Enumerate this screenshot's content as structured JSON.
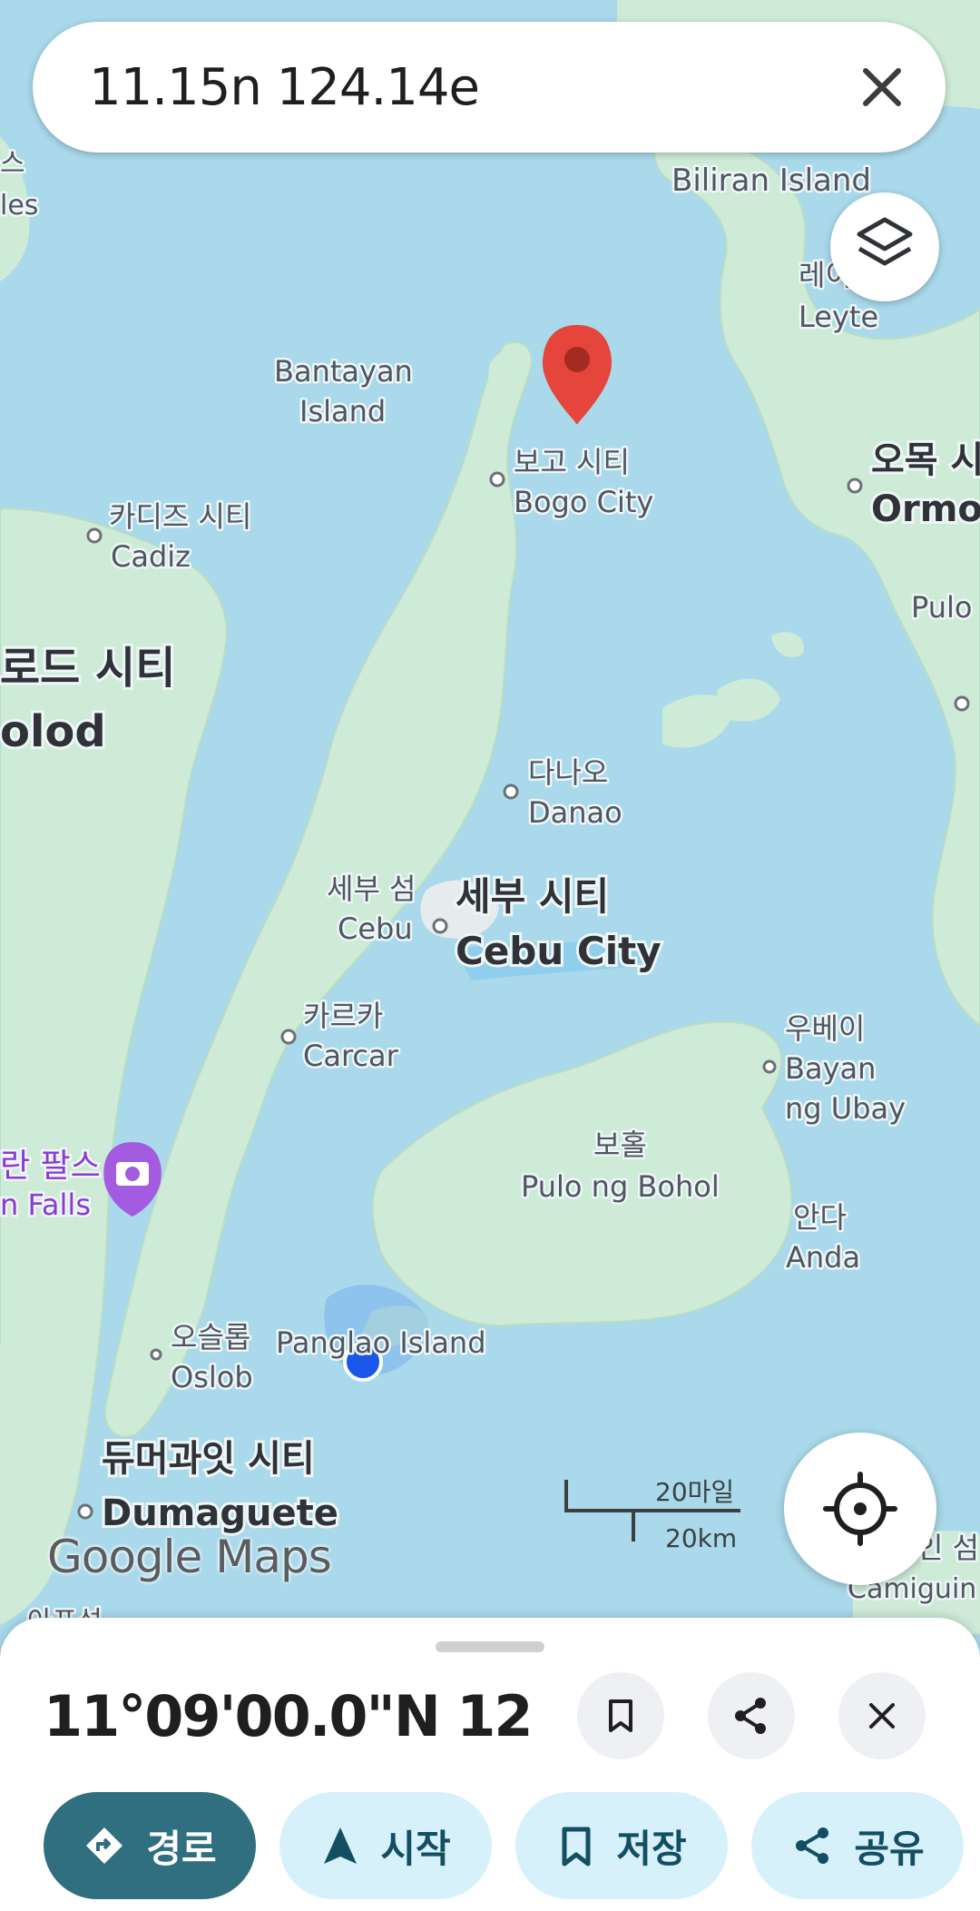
{
  "search": {
    "query": "11.15n 124.14e"
  },
  "map": {
    "labels": {
      "biliran": "Biliran Island",
      "leyte_ko": "레이",
      "leyte_en": "Leyte",
      "bantayan_1": "Bantayan",
      "bantayan_2": "Island",
      "bogo_ko": "보고 시티",
      "bogo_en": "Bogo City",
      "ormoc_ko": "오목 시",
      "ormoc_en": "Ormo",
      "cadiz_ko": "카디즈 시티",
      "cadiz_en": "Cadiz",
      "bacolod_ko": "로드 시티",
      "bacolod_en": "olod",
      "pulo_right": "Pulo",
      "danao_ko": "다나오",
      "danao_en": "Danao",
      "cebu_island_ko": "세부 섬",
      "cebu_island_en": "Cebu",
      "cebu_city_ko": "세부 시티",
      "cebu_city_en": "Cebu City",
      "carcar_ko": "카르카",
      "carcar_en": "Carcar",
      "ubay_ko": "우베이",
      "ubay_en_1": "Bayan",
      "ubay_en_2": "ng Ubay",
      "bohol_ko": "보홀",
      "bohol_en": "Pulo ng Bohol",
      "falls_ko": "란 팔스",
      "falls_en": "n Falls",
      "anda_ko": "안다",
      "anda_en": "Anda",
      "oslob_ko": "오슬롭",
      "oslob_en": "Oslob",
      "panglao": "Panglao Island",
      "dumaguete_ko": "듀머과잇 시티",
      "dumaguete_en": "Dumaguete",
      "camiguin_ko": "인 섬",
      "camiguin_en": "Camiguin",
      "bottom_ko": "아프섬",
      "top_left_1": "스",
      "top_left_2": "les"
    },
    "logo": "Google Maps",
    "scale": {
      "miles": "20마일",
      "km": "20km"
    },
    "colors": {
      "water": "#a9d9ea",
      "land": "#cdebd6",
      "pin": "#e5453b",
      "location_dot": "#1a56e8"
    }
  },
  "place": {
    "title": "11°09'00.0\"N 12..."
  },
  "actions": {
    "directions": "경로",
    "start": "시작",
    "save": "저장",
    "share": "공유"
  }
}
